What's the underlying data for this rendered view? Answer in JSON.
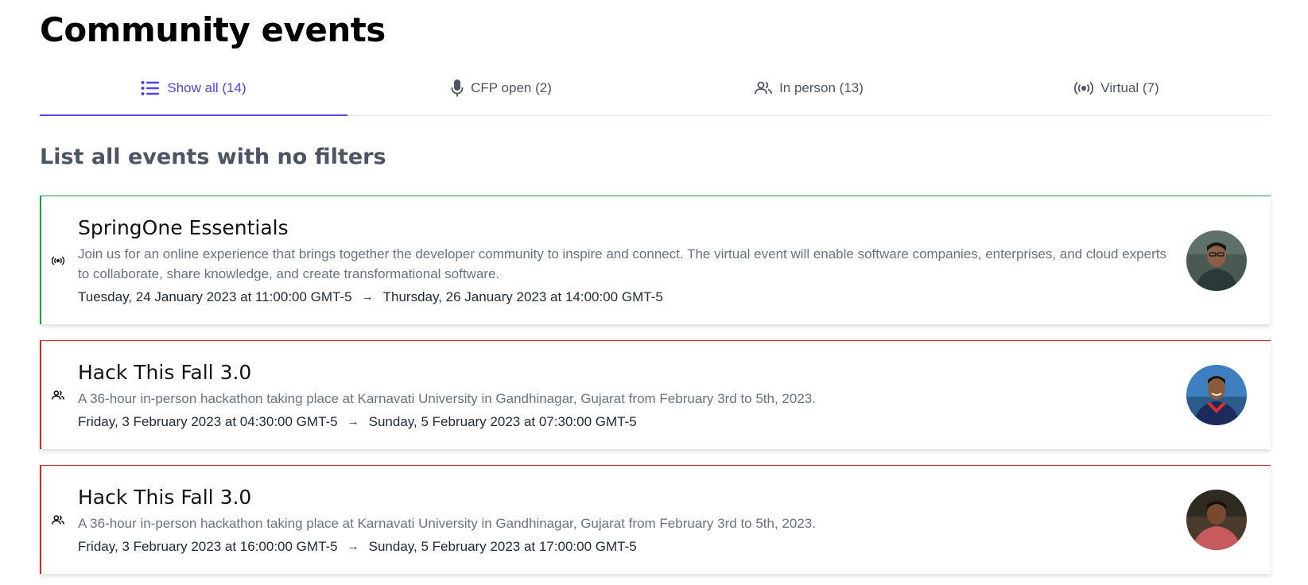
{
  "page": {
    "title": "Community events"
  },
  "tabs": [
    {
      "label": "Show all (14)",
      "icon": "list-icon",
      "active": true
    },
    {
      "label": "CFP open (2)",
      "icon": "microphone-icon",
      "active": false
    },
    {
      "label": "In person (13)",
      "icon": "people-icon",
      "active": false
    },
    {
      "label": "Virtual (7)",
      "icon": "broadcast-icon",
      "active": false
    }
  ],
  "section": {
    "title": "List all events with no filters"
  },
  "colors": {
    "accent": "#4f46e5",
    "virtual_border": "#16a34a",
    "in_person_border": "#dc2626"
  },
  "events": [
    {
      "type": "virtual",
      "type_icon": "broadcast-icon",
      "title": "SpringOne Essentials",
      "description": "Join us for an online experience that brings together the developer community to inspire and connect. The virtual event will enable software companies, enterprises, and cloud experts to collaborate, share knowledge, and create transformational software.",
      "start": "Tuesday, 24 January 2023 at 11:00:00 GMT-5",
      "arrow": "→",
      "end": "Thursday, 26 January 2023 at 14:00:00 GMT-5"
    },
    {
      "type": "in-person",
      "type_icon": "people-icon",
      "title": "Hack This Fall 3.0",
      "description": "A 36-hour in-person hackathon taking place at Karnavati University in Gandhinagar, Gujarat from February 3rd to 5th, 2023.",
      "start": "Friday, 3 February 2023 at 04:30:00 GMT-5",
      "arrow": "→",
      "end": "Sunday, 5 February 2023 at 07:30:00 GMT-5"
    },
    {
      "type": "in-person",
      "type_icon": "people-icon",
      "title": "Hack This Fall 3.0",
      "description": "A 36-hour in-person hackathon taking place at Karnavati University in Gandhinagar, Gujarat from February 3rd to 5th, 2023.",
      "start": "Friday, 3 February 2023 at 16:00:00 GMT-5",
      "arrow": "→",
      "end": "Sunday, 5 February 2023 at 17:00:00 GMT-5"
    }
  ]
}
